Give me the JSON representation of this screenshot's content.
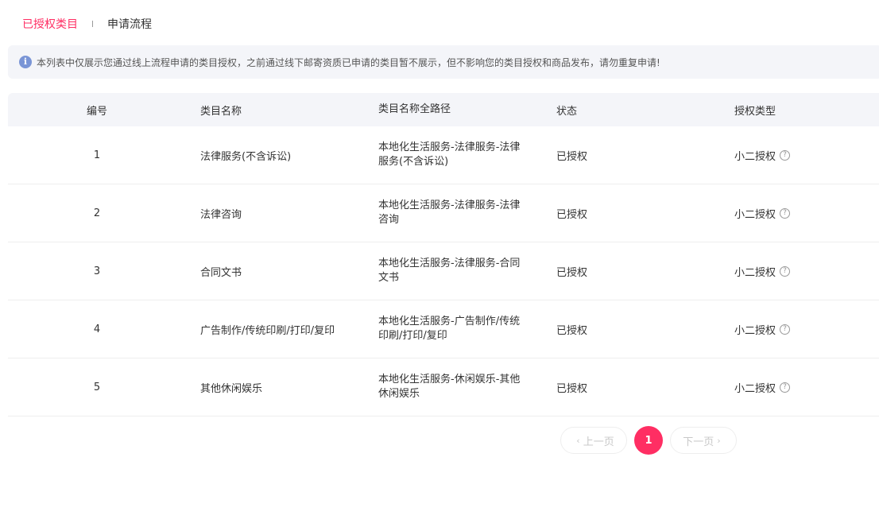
{
  "tabs": [
    {
      "label": "已授权类目",
      "active": true
    },
    {
      "label": "申请流程",
      "active": false
    }
  ],
  "notice": {
    "icon": "info-icon",
    "text": "本列表中仅展示您通过线上流程申请的类目授权，之前通过线下邮寄资质已申请的类目暂不展示，但不影响您的类目授权和商品发布，请勿重复申请!"
  },
  "table": {
    "headers": {
      "no": "编号",
      "name": "类目名称",
      "path": "类目名称全路径",
      "status": "状态",
      "type": "授权类型"
    },
    "rows": [
      {
        "no": "1",
        "name": "法律服务(不含诉讼)",
        "path": "本地化生活服务-法律服务-法律服务(不含诉讼)",
        "status": "已授权",
        "type": "小二授权"
      },
      {
        "no": "2",
        "name": "法律咨询",
        "path": "本地化生活服务-法律服务-法律咨询",
        "status": "已授权",
        "type": "小二授权"
      },
      {
        "no": "3",
        "name": "合同文书",
        "path": "本地化生活服务-法律服务-合同文书",
        "status": "已授权",
        "type": "小二授权"
      },
      {
        "no": "4",
        "name": "广告制作/传统印刷/打印/复印",
        "path": "本地化生活服务-广告制作/传统印刷/打印/复印",
        "status": "已授权",
        "type": "小二授权"
      },
      {
        "no": "5",
        "name": "其他休闲娱乐",
        "path": "本地化生活服务-休闲娱乐-其他休闲娱乐",
        "status": "已授权",
        "type": "小二授权"
      }
    ]
  },
  "pagination": {
    "prev": "上一页",
    "current": "1",
    "next": "下一页"
  },
  "colors": {
    "accent": "#ff2e63",
    "notice_bg": "#f4f5f9",
    "info_icon": "#7a95d6"
  }
}
